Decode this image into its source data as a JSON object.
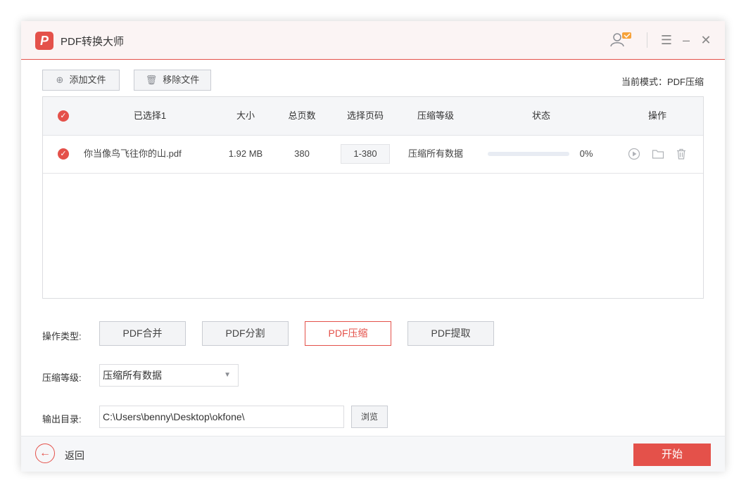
{
  "app": {
    "title": "PDF转换大师",
    "logo_glyph": "P"
  },
  "colors": {
    "accent": "#e4514a",
    "header_bg": "#fbf4f4",
    "table_header_bg": "#f5f6f8"
  },
  "toolbar": {
    "add_file": "添加文件",
    "remove_file": "移除文件",
    "mode_text": "当前模式：PDF压缩"
  },
  "table": {
    "headers": [
      "已选择1",
      "大小",
      "总页数",
      "选择页码",
      "压缩等级",
      "状态",
      "操作"
    ],
    "rows": [
      {
        "name": "你当像鸟飞往你的山.pdf",
        "size": "1.92 MB",
        "pages": "380",
        "range": "1-380",
        "level": "压缩所有数据",
        "progress_pct": 0,
        "progress_text": "0%"
      }
    ]
  },
  "operation": {
    "label": "操作类型:",
    "buttons": [
      "PDF合并",
      "PDF分割",
      "PDF压缩",
      "PDF提取"
    ],
    "active": "PDF压缩"
  },
  "compression": {
    "label": "压缩等级:",
    "value": "压缩所有数据"
  },
  "output": {
    "label": "输出目录:",
    "path": "C:\\Users\\benny\\Desktop\\okfone\\",
    "browse": "浏览"
  },
  "footer": {
    "back": "返回",
    "start": "开始"
  },
  "icons": [
    "user-badge-icon",
    "menu-icon",
    "minimize-icon",
    "close-icon",
    "add-circle-icon",
    "trash-icon",
    "check-circle-icon",
    "play-icon",
    "folder-icon",
    "back-arrow-icon",
    "dropdown-arrow-icon"
  ]
}
